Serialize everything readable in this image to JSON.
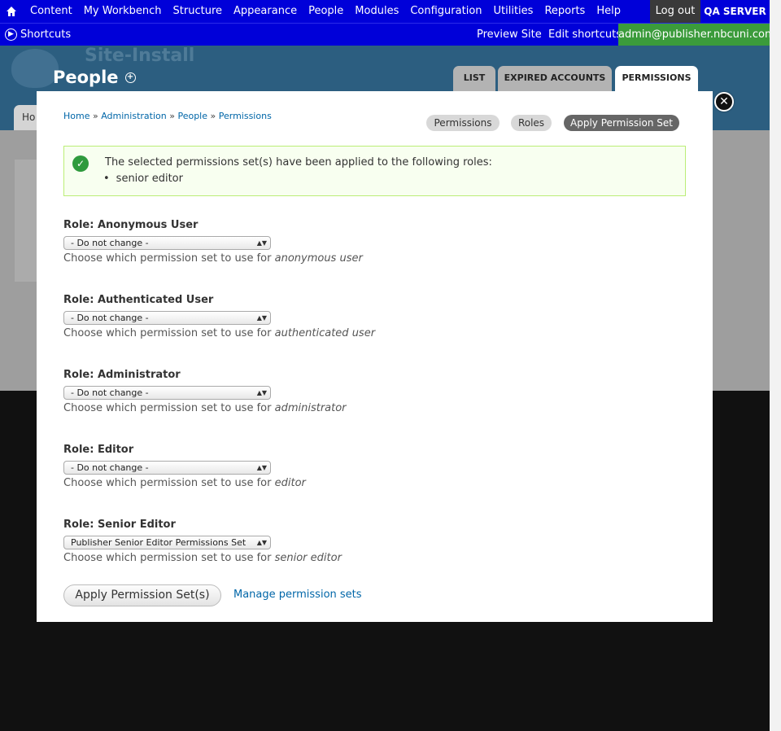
{
  "toolbar": {
    "menu": [
      "Content",
      "My Workbench",
      "Structure",
      "Appearance",
      "People",
      "Modules",
      "Configuration",
      "Utilities",
      "Reports",
      "Help"
    ],
    "logout": "Log out",
    "server": "QA SERVER"
  },
  "shortcuts_bar": {
    "shortcuts": "Shortcuts",
    "preview_site": "Preview Site",
    "edit_shortcuts": "Edit shortcuts",
    "user": "admin@publisher.nbcuni.com"
  },
  "header": {
    "site_name": "Site-Install",
    "page_title": "People",
    "tabs": [
      "LIST",
      "EXPIRED ACCOUNTS",
      "PERMISSIONS"
    ],
    "home_tab": "Ho"
  },
  "modal": {
    "breadcrumb": [
      "Home",
      "Administration",
      "People",
      "Permissions"
    ],
    "breadcrumb_sep": "»",
    "pills": [
      "Permissions",
      "Roles",
      "Apply Permission Set"
    ],
    "status": {
      "message": "The selected permissions set(s) have been applied to the following roles:",
      "roles": [
        "senior editor"
      ]
    },
    "desc_prefix": "Choose which permission set to use for",
    "roles": [
      {
        "label": "Role: Anonymous User",
        "select": "- Do not change -",
        "role": "anonymous user"
      },
      {
        "label": "Role: Authenticated User",
        "select": "- Do not change -",
        "role": "authenticated user"
      },
      {
        "label": "Role: Administrator",
        "select": "- Do not change -",
        "role": "administrator"
      },
      {
        "label": "Role: Editor",
        "select": "- Do not change -",
        "role": "editor"
      },
      {
        "label": "Role: Senior Editor",
        "select": "Publisher Senior Editor Permissions Set",
        "role": "senior editor"
      }
    ],
    "apply_button": "Apply Permission Set(s)",
    "manage_link": "Manage permission sets"
  },
  "colors": {
    "toolbar": "#0000d9",
    "user_badge": "#3b9b3b",
    "header": "#2c5e80",
    "link": "#0066a8",
    "status_bg": "#f8fff0",
    "status_border": "#bbee77"
  }
}
